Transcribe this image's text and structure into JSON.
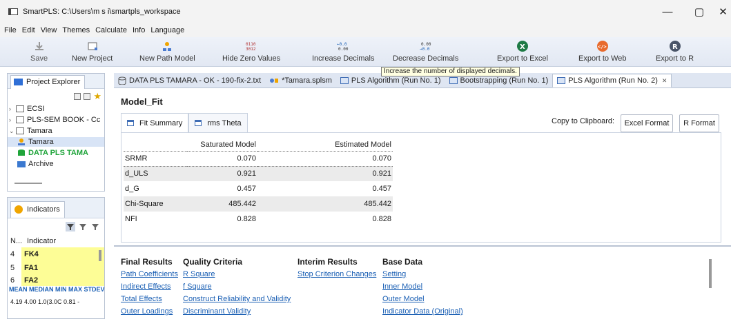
{
  "window": {
    "title": "SmartPLS: C:\\Users\\m s i\\smartpls_workspace",
    "minimize": "—",
    "maximize": "▢",
    "close": "✕"
  },
  "menu": [
    "File",
    "Edit",
    "View",
    "Themes",
    "Calculate",
    "Info",
    "Language"
  ],
  "toolbar": {
    "save": "Save",
    "new_project": "New Project",
    "new_path_model": "New Path Model",
    "hide_zero": "Hide Zero Values",
    "increase_decimals": "Increase Decimals",
    "decrease_decimals": "Decrease Decimals",
    "export_excel": "Export to Excel",
    "export_web": "Export to Web",
    "export_r": "Export to R",
    "hide_zero_glyph": "0.1 1 0\n3.0 1 2",
    "inc_glyph": "+0.0\n0.00",
    "dec_glyph": "0.00\n+0.0",
    "r_glyph": "R",
    "web_glyph": "</>",
    "excel_glyph": "X"
  },
  "tooltip": "Increase the number of displayed decimals.",
  "project_explorer": {
    "title": "Project Explorer",
    "items": [
      {
        "label": "ECSI",
        "chevron": "›"
      },
      {
        "label": "PLS-SEM BOOK - Cc",
        "chevron": "›"
      },
      {
        "label": "Tamara",
        "chevron": "⌄"
      },
      {
        "label": "Tamara"
      },
      {
        "label": "DATA PLS TAMA"
      },
      {
        "label": "Archive"
      }
    ]
  },
  "indicators": {
    "title": "Indicators",
    "col_n": "N...",
    "col_indicator": "Indicator",
    "rows": [
      {
        "n": "4",
        "name": "FK4"
      },
      {
        "n": "5",
        "name": "FA1"
      },
      {
        "n": "6",
        "name": "FA2"
      }
    ],
    "stats_header": "MEAN MEDIAN MIN MAX STDEV MISSING",
    "stats_values": "4.19  4.00  1.0(3.0C 0.81   -"
  },
  "editor_tabs": [
    "DATA PLS TAMARA - OK - 190-fix-2.txt",
    "*Tamara.splsm",
    "PLS Algorithm (Run No. 1)",
    "Bootstrapping (Run No. 1)",
    "PLS Algorithm (Run No. 2)"
  ],
  "active_tab_close": "✕",
  "model_fit": {
    "title": "Model_Fit",
    "tabs": [
      "Fit Summary",
      "rms Theta"
    ],
    "copy_label": "Copy to Clipboard:",
    "excel_button": "Excel Format",
    "r_button": "R Format",
    "columns": [
      "",
      "Saturated Model",
      "Estimated Model"
    ],
    "rows": [
      {
        "name": "SRMR",
        "saturated": "0.070",
        "estimated": "0.070"
      },
      {
        "name": "d_ULS",
        "saturated": "0.921",
        "estimated": "0.921"
      },
      {
        "name": "d_G",
        "saturated": "0.457",
        "estimated": "0.457"
      },
      {
        "name": "Chi-Square",
        "saturated": "485.442",
        "estimated": "485.442"
      },
      {
        "name": "NFI",
        "saturated": "0.828",
        "estimated": "0.828"
      }
    ]
  },
  "results_nav": {
    "final": {
      "head": "Final Results",
      "links": [
        "Path Coefficients",
        "Indirect Effects",
        "Total Effects",
        "Outer Loadings"
      ]
    },
    "quality": {
      "head": "Quality Criteria",
      "links": [
        "R Square",
        "f Square",
        "Construct Reliability and Validity",
        "Discriminant Validity"
      ]
    },
    "interim": {
      "head": "Interim Results",
      "links": [
        "Stop Criterion Changes"
      ]
    },
    "base": {
      "head": "Base Data",
      "links": [
        "Setting",
        "Inner Model",
        "Outer Model",
        "Indicator Data (Original)"
      ]
    }
  }
}
